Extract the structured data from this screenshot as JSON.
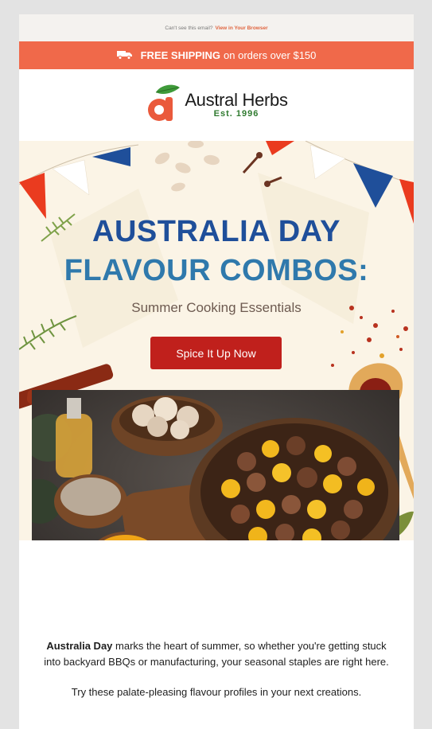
{
  "preheader": {
    "text": "Can't see this email?",
    "link": "View in Your Browser"
  },
  "shipping": {
    "bold": "FREE SHIPPING",
    "rest": "on orders over $150"
  },
  "brand": {
    "name": "Austral Herbs",
    "est": "Est. 1996",
    "logo_letter": "a"
  },
  "hero": {
    "title_line1": "AUSTRALIA DAY",
    "title_line2": "FLAVOUR COMBOS:",
    "subtitle": "Summer Cooking Essentials",
    "cta": "Spice It Up Now"
  },
  "copy": {
    "p1_bold": "Australia Day",
    "p1_rest": "marks the heart of summer, so whether you're getting stuck into backyard BBQs or manufacturing, your seasonal staples are right here.",
    "p2": "Try these palate-pleasing flavour profiles in your next creations."
  },
  "colors": {
    "accent": "#f0694a",
    "cta": "#c0201c",
    "title_dark": "#1f4f9a",
    "title_light": "#2f79ac"
  }
}
